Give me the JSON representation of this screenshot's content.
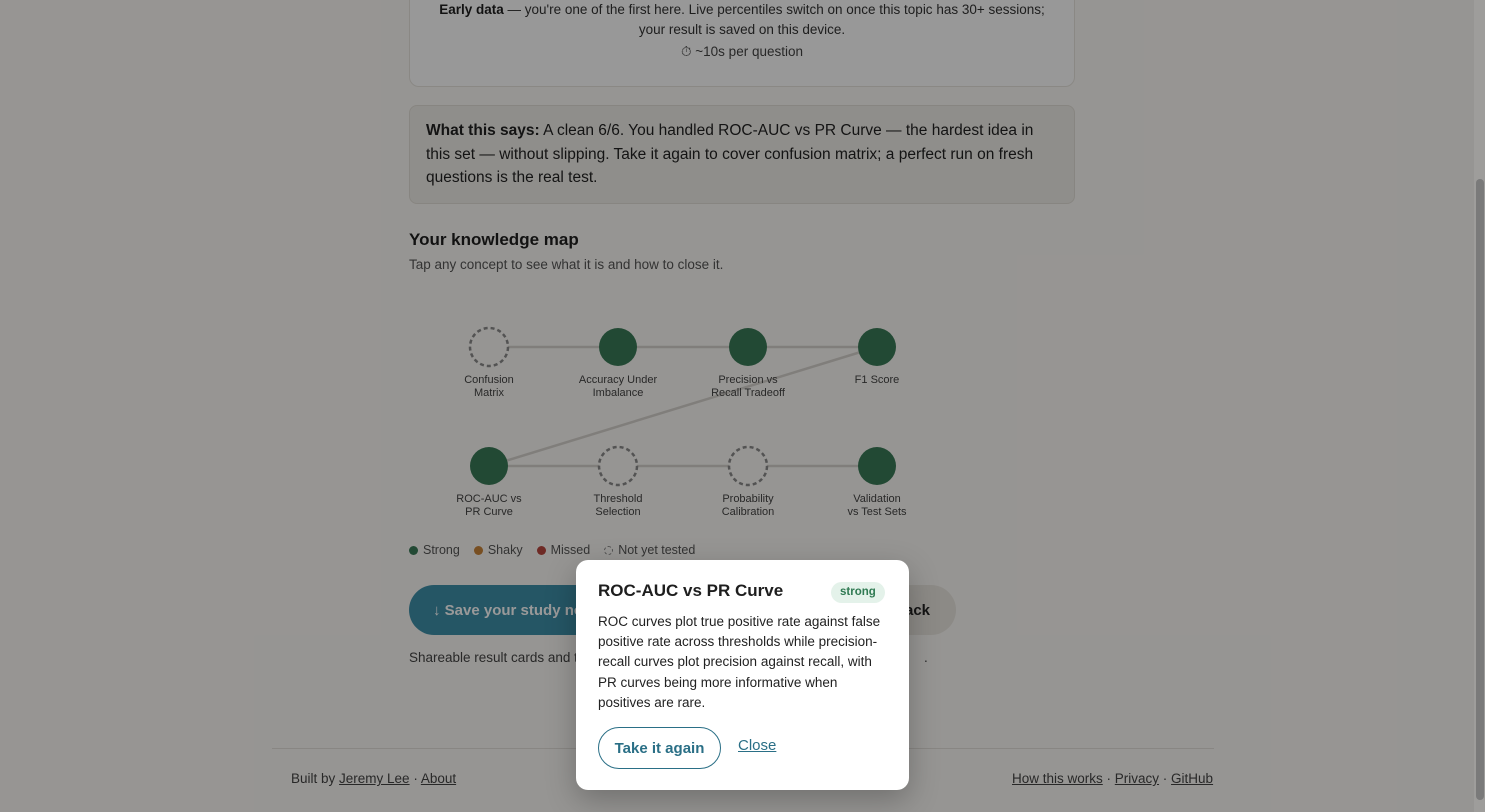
{
  "early_data": {
    "label": "Early data",
    "text": " — you're one of the first here. Live percentiles switch on once this topic has 30+ sessions; your result is saved on this device.",
    "time_icon": "stopwatch-icon",
    "time_glyph": "⏱",
    "time_text": " ~10s per question"
  },
  "what_this_says": {
    "label": "What this says:",
    "text": " A clean 6/6. You handled ROC-AUC vs PR Curve — the hardest idea in this set — without slipping. Take it again to cover confusion matrix; a perfect run on fresh questions is the real test."
  },
  "knowledge_map": {
    "title": "Your knowledge map",
    "subtitle": "Tap any concept to see what it is and how to close it.",
    "nodes": [
      {
        "line1": "Confusion",
        "line2": "Matrix",
        "status": "not_tested"
      },
      {
        "line1": "Accuracy Under",
        "line2": "Imbalance",
        "status": "strong"
      },
      {
        "line1": "Precision vs",
        "line2": "Recall Tradeoff",
        "status": "strong"
      },
      {
        "line1": "F1 Score",
        "line2": "",
        "status": "strong"
      },
      {
        "line1": "ROC-AUC vs",
        "line2": "PR Curve",
        "status": "strong"
      },
      {
        "line1": "Threshold",
        "line2": "Selection",
        "status": "not_tested"
      },
      {
        "line1": "Probability",
        "line2": "Calibration",
        "status": "not_tested"
      },
      {
        "line1": "Validation",
        "line2": "vs Test Sets",
        "status": "strong"
      }
    ],
    "colors": {
      "strong": "#3a7a57",
      "shaky": "#c8843a",
      "missed": "#b8473e",
      "not_tested": "#8a8a8a",
      "edge": "#d6d3cd"
    }
  },
  "legend": {
    "strong": "Strong",
    "shaky": "Shaky",
    "missed": "Missed",
    "not_tested": "Not yet tested"
  },
  "actions": {
    "save_label": "↓ Save your study note",
    "back_label": "Back"
  },
  "share_note": {
    "text": "Shareable result cards and the",
    "link_text": "ng",
    "end": "."
  },
  "footer": {
    "built_by": "Built by ",
    "author": "Jeremy Lee",
    "sep": " · ",
    "about": "About",
    "how": "How this works",
    "privacy": "Privacy",
    "github": "GitHub"
  },
  "modal": {
    "title": "ROC-AUC vs PR Curve",
    "badge": "strong",
    "body": "ROC curves plot true positive rate against false positive rate across thresholds while precision-recall curves plot precision against recall, with PR curves being more informative when positives are rare.",
    "retake_label": "Take it again",
    "close_label": "Close"
  }
}
